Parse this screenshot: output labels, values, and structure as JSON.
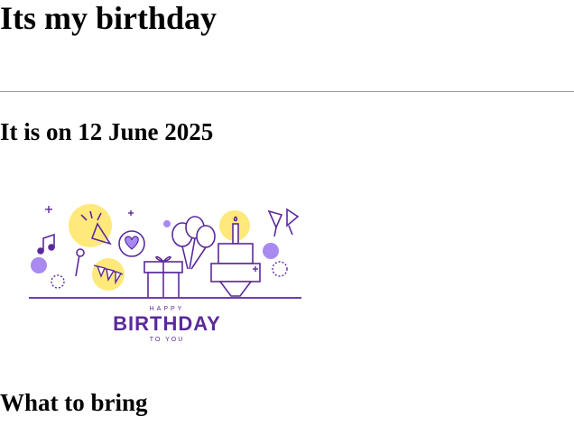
{
  "page": {
    "title": "Its my birthday",
    "date_heading": "It is on 12 June 2025",
    "bring_heading": "What to bring"
  },
  "banner": {
    "small_top": "HAPPY",
    "main": "BIRTHDAY",
    "small_bottom": "TO YOU"
  },
  "colors": {
    "accent_purple": "#5b2a9a",
    "line_purple": "#6a3fb3",
    "yellow": "#ffe97a",
    "light_purple": "#a98af0"
  }
}
